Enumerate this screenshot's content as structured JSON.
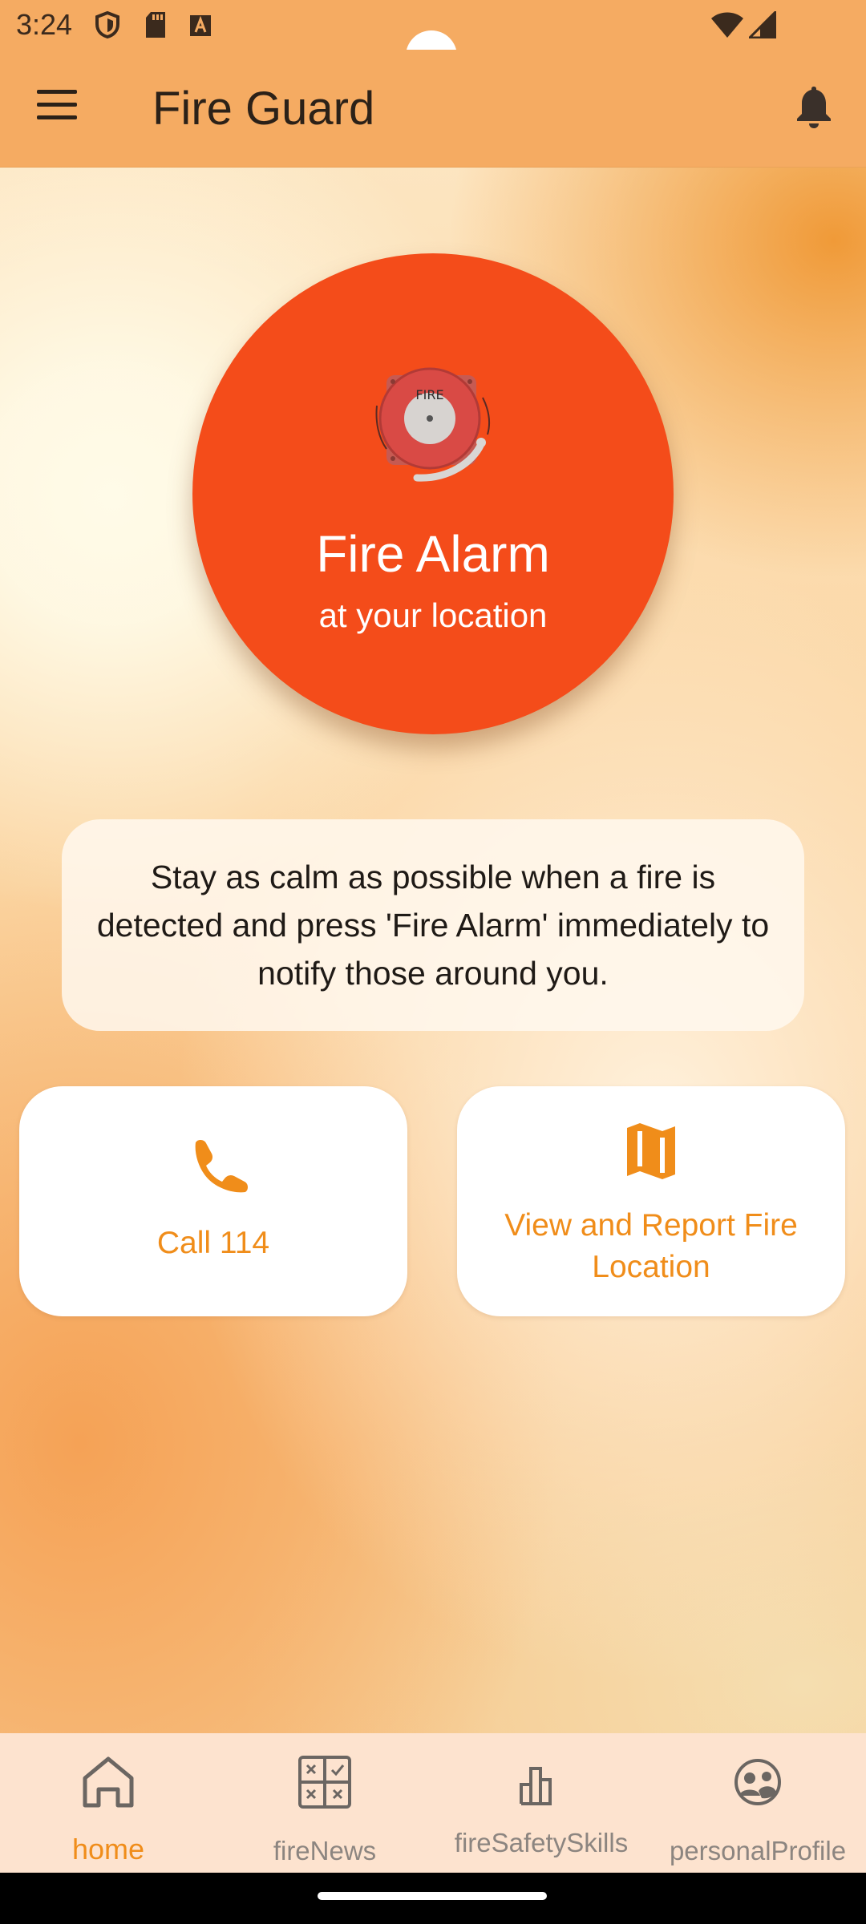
{
  "status_bar": {
    "time": "3:24",
    "left_icons": [
      "shield-icon",
      "sd-card-icon",
      "keyboard-a-icon"
    ],
    "right_icons": [
      "wifi-icon",
      "signal-icon"
    ]
  },
  "app_bar": {
    "title": "Fire Guard",
    "menu_icon": "menu-icon",
    "action_icon": "bell-icon"
  },
  "alarm_button": {
    "title": "Fire Alarm",
    "subtitle": "at your location",
    "image_text": "FIRE",
    "color": "#f44c1a"
  },
  "info_text": "Stay as calm as possible when a fire is detected and press 'Fire Alarm' immediately to notify those around you.",
  "actions": [
    {
      "label": "Call 114",
      "icon": "phone-icon"
    },
    {
      "label": "View and Report Fire Location",
      "icon": "map-icon"
    }
  ],
  "bottom_nav": {
    "items": [
      {
        "label": "home",
        "icon": "home-icon",
        "active": true
      },
      {
        "label": "fireNews",
        "icon": "grid-icon",
        "active": false
      },
      {
        "label": "fireSafetySkills",
        "icon": "bar-chart-icon",
        "active": false
      },
      {
        "label": "personalProfile",
        "icon": "people-icon",
        "active": false
      }
    ]
  },
  "colors": {
    "accent": "#f08d1a",
    "app_bar": "#f5ab62",
    "nav_bg": "#fde3cf"
  }
}
